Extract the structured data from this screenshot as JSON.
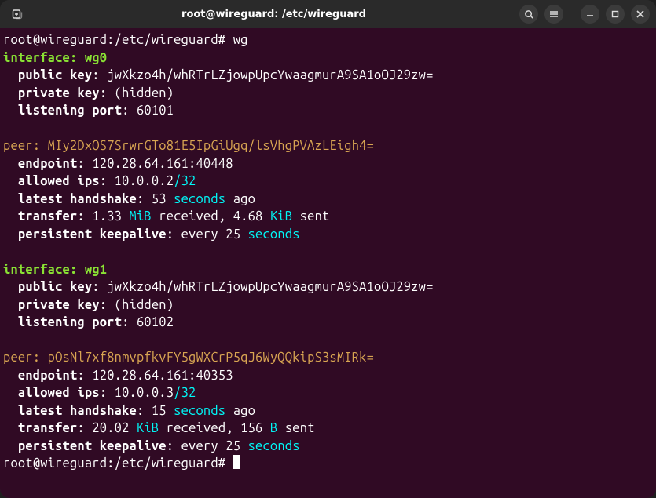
{
  "titlebar": {
    "title": "root@wireguard: /etc/wireguard"
  },
  "prompt": {
    "user_host": "root@wireguard",
    "path": "/etc/wireguard",
    "command": "wg"
  },
  "interfaces": [
    {
      "heading": "interface",
      "name": "wg0",
      "public_key_label": "public key",
      "public_key": "jwXkzo4h/whRTrLZjowpUpcYwaagmurA9SA1oOJ29zw=",
      "private_key_label": "private key",
      "private_key": "(hidden)",
      "listening_port_label": "listening port",
      "listening_port": "60101",
      "peer": {
        "heading": "peer",
        "key": "MIy2DxOS7SrwrGTo81E5IpGiUgq/lsVhgPVAzLEigh4=",
        "endpoint_label": "endpoint",
        "endpoint": "120.28.64.161:40448",
        "allowed_ips_label": "allowed ips",
        "allowed_ips_ip": "10.0.0.2",
        "allowed_ips_mask": "/32",
        "handshake_label": "latest handshake",
        "handshake_num": "53",
        "handshake_unit": "seconds",
        "handshake_suffix": "ago",
        "transfer_label": "transfer",
        "transfer_rx_num": "1.33",
        "transfer_rx_unit": "MiB",
        "transfer_rx_word": "received,",
        "transfer_tx_num": "4.68",
        "transfer_tx_unit": "KiB",
        "transfer_tx_word": "sent",
        "keepalive_label": "persistent keepalive",
        "keepalive_pre": "every",
        "keepalive_num": "25",
        "keepalive_unit": "seconds"
      }
    },
    {
      "heading": "interface",
      "name": "wg1",
      "public_key_label": "public key",
      "public_key": "jwXkzo4h/whRTrLZjowpUpcYwaagmurA9SA1oOJ29zw=",
      "private_key_label": "private key",
      "private_key": "(hidden)",
      "listening_port_label": "listening port",
      "listening_port": "60102",
      "peer": {
        "heading": "peer",
        "key": "pOsNl7xf8nmvpfkvFY5gWXCrP5qJ6WyQQkipS3sMIRk=",
        "endpoint_label": "endpoint",
        "endpoint": "120.28.64.161:40353",
        "allowed_ips_label": "allowed ips",
        "allowed_ips_ip": "10.0.0.3",
        "allowed_ips_mask": "/32",
        "handshake_label": "latest handshake",
        "handshake_num": "15",
        "handshake_unit": "seconds",
        "handshake_suffix": "ago",
        "transfer_label": "transfer",
        "transfer_rx_num": "20.02",
        "transfer_rx_unit": "KiB",
        "transfer_rx_word": "received,",
        "transfer_tx_num": "156",
        "transfer_tx_unit": "B",
        "transfer_tx_word": "sent",
        "keepalive_label": "persistent keepalive",
        "keepalive_pre": "every",
        "keepalive_num": "25",
        "keepalive_unit": "seconds"
      }
    }
  ]
}
